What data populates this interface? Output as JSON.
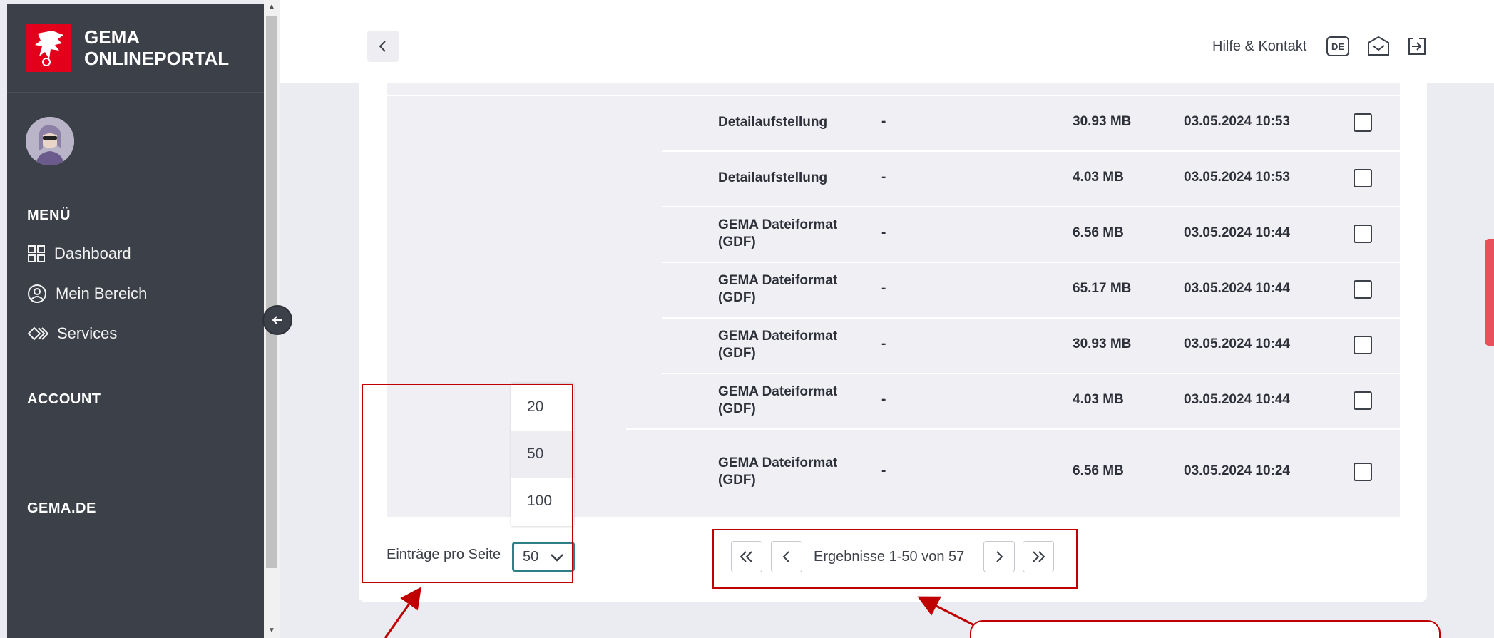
{
  "sidebar": {
    "logo_line1": "GEMA",
    "logo_line2": "ONLINEPORTAL",
    "menu_title": "MENÜ",
    "items": [
      {
        "label": "Dashboard",
        "icon": "grid-icon"
      },
      {
        "label": "Mein Bereich",
        "icon": "user-circle-icon"
      },
      {
        "label": "Services",
        "icon": "services-icon"
      }
    ],
    "account_title": "ACCOUNT",
    "gema_title": "GEMA.DE"
  },
  "header": {
    "help_label": "Hilfe & Kontakt",
    "lang_label": "DE"
  },
  "table": {
    "rows": [
      {
        "type": "Detailaufstellung",
        "dash": "-",
        "size": "30.93 MB",
        "date": "03.05.2024 10:53"
      },
      {
        "type": "Detailaufstellung",
        "dash": "-",
        "size": "4.03 MB",
        "date": "03.05.2024 10:53"
      },
      {
        "type": "GEMA Dateiformat (GDF)",
        "dash": "-",
        "size": "6.56 MB",
        "date": "03.05.2024 10:44"
      },
      {
        "type": "GEMA Dateiformat (GDF)",
        "dash": "-",
        "size": "65.17 MB",
        "date": "03.05.2024 10:44"
      },
      {
        "type": "GEMA Dateiformat (GDF)",
        "dash": "-",
        "size": "30.93 MB",
        "date": "03.05.2024 10:44"
      },
      {
        "type": "GEMA Dateiformat (GDF)",
        "dash": "-",
        "size": "4.03 MB",
        "date": "03.05.2024 10:44"
      },
      {
        "type": "GEMA Dateiformat (GDF)",
        "dash": "-",
        "size": "6.56 MB",
        "date": "03.05.2024 10:24"
      }
    ]
  },
  "pagination": {
    "per_page_label": "Einträge pro Seite",
    "per_page_value": "50",
    "options": [
      "20",
      "50",
      "100"
    ],
    "results_text": "Ergebnisse 1-50 von 57"
  },
  "colors": {
    "sidebar_bg": "#3c4048",
    "brand_red": "#e2001a",
    "annotation_red": "#c00000",
    "focus_teal": "#2e7f86"
  }
}
